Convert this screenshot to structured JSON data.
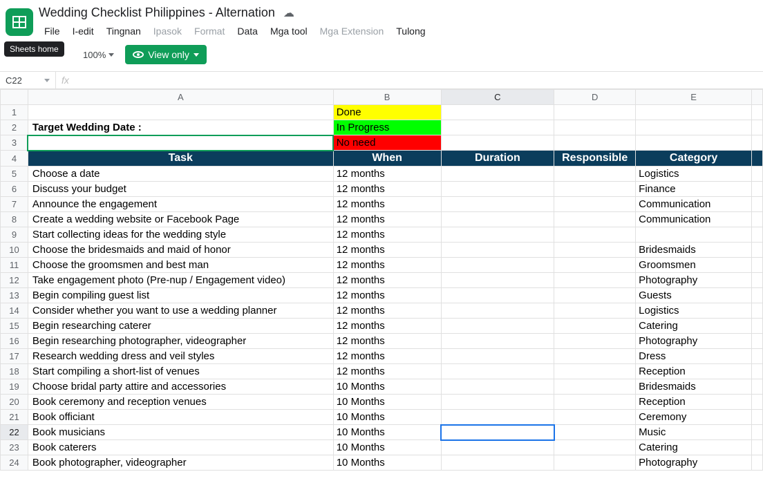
{
  "header": {
    "title": "Wedding Checklist Philippines - Alternation",
    "tooltip": "Sheets home"
  },
  "menu": {
    "file": "File",
    "edit": "I-edit",
    "view": "Tingnan",
    "insert": "Ipasok",
    "format": "Format",
    "data": "Data",
    "tools": "Mga tool",
    "extensions": "Mga Extension",
    "help": "Tulong"
  },
  "toolbar": {
    "zoom": "100%",
    "view_only": "View only"
  },
  "namebox": "C22",
  "fx_symbol": "fx",
  "columns": [
    "A",
    "B",
    "C",
    "D",
    "E"
  ],
  "status": {
    "done": "Done",
    "inprogress": "In Progress",
    "noneed": "No need"
  },
  "row2": {
    "label": "Target Wedding Date :"
  },
  "headers": {
    "task": "Task",
    "when": "When",
    "duration": "Duration",
    "responsible": "Responsible",
    "category": "Category"
  },
  "rows": [
    {
      "n": 5,
      "task": "Choose a date",
      "when": "12 months",
      "cat": "Logistics"
    },
    {
      "n": 6,
      "task": "Discuss your budget",
      "when": "12 months",
      "cat": "Finance"
    },
    {
      "n": 7,
      "task": "Announce the engagement",
      "when": "12 months",
      "cat": "Communication"
    },
    {
      "n": 8,
      "task": "Create a wedding website or Facebook Page",
      "when": "12 months",
      "cat": "Communication"
    },
    {
      "n": 9,
      "task": "Start collecting ideas for the wedding style",
      "when": "12 months",
      "cat": ""
    },
    {
      "n": 10,
      "task": "Choose the bridesmaids and maid of honor",
      "when": "12 months",
      "cat": "Bridesmaids"
    },
    {
      "n": 11,
      "task": "Choose the groomsmen and best man",
      "when": "12 months",
      "cat": "Groomsmen"
    },
    {
      "n": 12,
      "task": "Take engagement photo (Pre-nup / Engagement video)",
      "when": "12 months",
      "cat": "Photography"
    },
    {
      "n": 13,
      "task": "Begin compiling guest list",
      "when": "12 months",
      "cat": "Guests"
    },
    {
      "n": 14,
      "task": "Consider whether you want to use a wedding planner",
      "when": "12 months",
      "cat": "Logistics"
    },
    {
      "n": 15,
      "task": "Begin researching caterer",
      "when": "12 months",
      "cat": "Catering"
    },
    {
      "n": 16,
      "task": "Begin researching photographer, videographer",
      "when": "12 months",
      "cat": "Photography"
    },
    {
      "n": 17,
      "task": "Research wedding dress and veil styles",
      "when": "12 months",
      "cat": "Dress"
    },
    {
      "n": 18,
      "task": "Start compiling a short-list of venues",
      "when": "12 months",
      "cat": "Reception"
    },
    {
      "n": 19,
      "task": "Choose bridal party attire and accessories",
      "when": "10 Months",
      "cat": "Bridesmaids"
    },
    {
      "n": 20,
      "task": "Book ceremony and reception venues",
      "when": "10 Months",
      "cat": "Reception"
    },
    {
      "n": 21,
      "task": "Book officiant",
      "when": "10 Months",
      "cat": "Ceremony"
    },
    {
      "n": 22,
      "task": "Book musicians",
      "when": "10 Months",
      "cat": "Music"
    },
    {
      "n": 23,
      "task": "Book caterers",
      "when": "10 Months",
      "cat": "Catering"
    },
    {
      "n": 24,
      "task": "Book photographer, videographer",
      "when": "10 Months",
      "cat": "Photography"
    }
  ]
}
